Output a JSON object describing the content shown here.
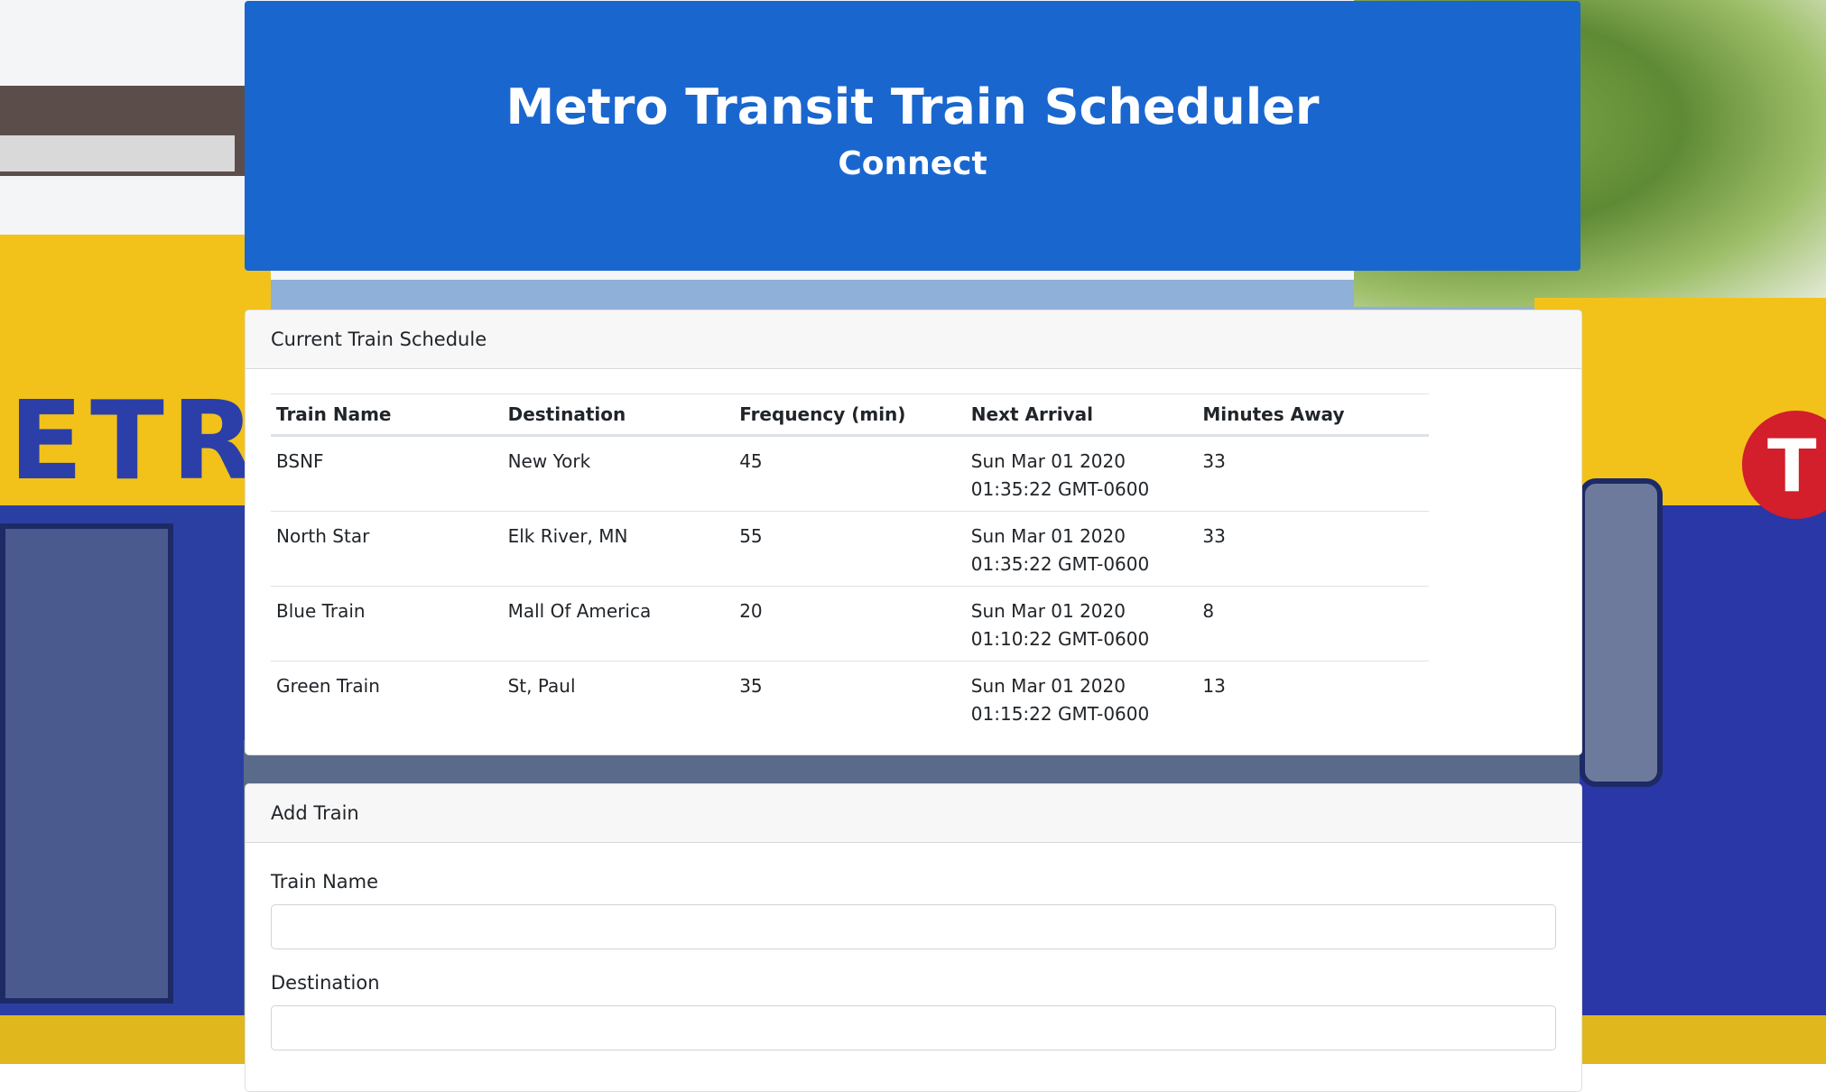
{
  "header": {
    "title": "Metro Transit Train Scheduler",
    "subtitle": "Connect"
  },
  "schedule": {
    "card_title": "Current Train Schedule",
    "columns": [
      "Train Name",
      "Destination",
      "Frequency (min)",
      "Next Arrival",
      "Minutes Away"
    ],
    "rows": [
      {
        "name": "BSNF",
        "destination": "New York",
        "frequency": "45",
        "next_arrival": "Sun Mar 01 2020 01:35:22 GMT-0600",
        "minutes_away": "33"
      },
      {
        "name": "North Star",
        "destination": "Elk River, MN",
        "frequency": "55",
        "next_arrival": "Sun Mar 01 2020 01:35:22 GMT-0600",
        "minutes_away": "33"
      },
      {
        "name": "Blue Train",
        "destination": "Mall Of America",
        "frequency": "20",
        "next_arrival": "Sun Mar 01 2020 01:10:22 GMT-0600",
        "minutes_away": "8"
      },
      {
        "name": "Green Train",
        "destination": "St, Paul",
        "frequency": "35",
        "next_arrival": "Sun Mar 01 2020 01:15:22 GMT-0600",
        "minutes_away": "13"
      }
    ]
  },
  "add_train": {
    "card_title": "Add Train",
    "train_name_label": "Train Name",
    "train_name_value": "",
    "destination_label": "Destination",
    "destination_value": ""
  },
  "background": {
    "image": "metro-transit-train-photo",
    "header_color": "#1a66cf"
  }
}
